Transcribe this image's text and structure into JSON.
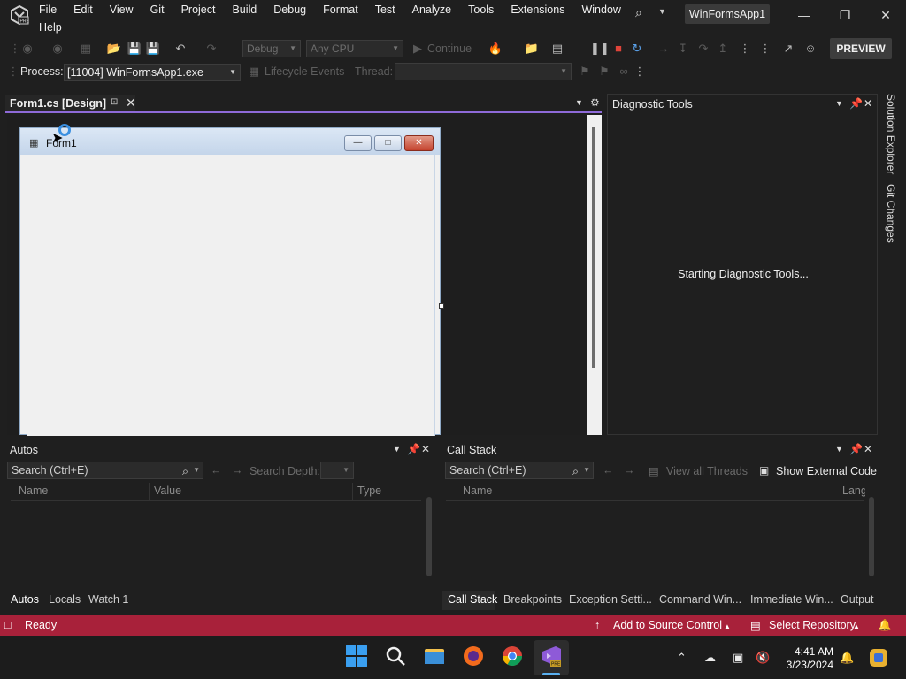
{
  "titlebar": {
    "menu": [
      "File",
      "Edit",
      "View",
      "Git",
      "Project",
      "Build",
      "Debug",
      "Format",
      "Test",
      "Analyze",
      "Tools",
      "Extensions",
      "Window",
      "Help"
    ],
    "solution_name": "WinFormsApp1"
  },
  "toolbar": {
    "config": "Debug",
    "platform": "Any CPU",
    "continue_label": "Continue",
    "preview_label": "PREVIEW",
    "process_label": "Process:",
    "process_value": "[11004] WinFormsApp1.exe",
    "lifecycle_label": "Lifecycle Events",
    "thread_label": "Thread:"
  },
  "doc_tab": {
    "title": "Form1.cs [Design]"
  },
  "form1": {
    "title": "Form1"
  },
  "diagnostic": {
    "title": "Diagnostic Tools",
    "status": "Starting Diagnostic Tools..."
  },
  "side_tabs": [
    "Solution Explorer",
    "Git Changes"
  ],
  "autos": {
    "title": "Autos",
    "search_placeholder": "Search (Ctrl+E)",
    "search_depth_label": "Search Depth:",
    "columns": [
      "Name",
      "Value",
      "Type"
    ],
    "tabs": [
      "Autos",
      "Locals",
      "Watch 1"
    ]
  },
  "callstack": {
    "title": "Call Stack",
    "search_placeholder": "Search (Ctrl+E)",
    "view_threads_label": "View all Threads",
    "show_external_label": "Show External Code",
    "columns": [
      "Name",
      "Lang"
    ],
    "tabs": [
      "Call Stack",
      "Breakpoints",
      "Exception Setti...",
      "Command Win...",
      "Immediate Win...",
      "Output"
    ]
  },
  "statusbar": {
    "ready": "Ready",
    "add_source": "Add to Source Control",
    "select_repo": "Select Repository"
  },
  "taskbar": {
    "time": "4:41 AM",
    "date": "3/23/2024"
  },
  "colors": {
    "accent": "#8e6ad8",
    "statusbar": "#a8213a"
  }
}
